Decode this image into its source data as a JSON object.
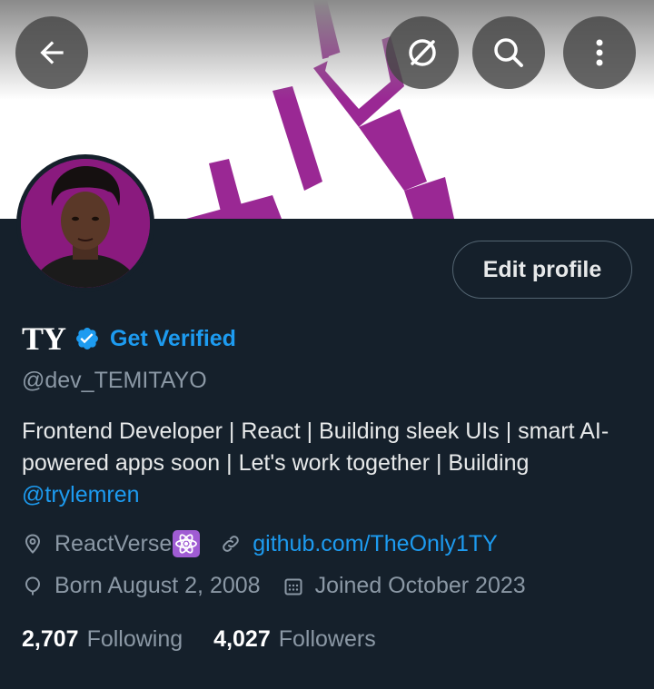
{
  "profile": {
    "display_name": "TY",
    "get_verified_label": "Get Verified",
    "handle": "@dev_TEMITAYO",
    "bio_text": "Frontend Developer | React | Building sleek UIs | smart AI-powered apps soon | Let's work together | Building ",
    "bio_mention": "@trylemren",
    "location": "ReactVerse",
    "location_emoji": "atom-symbol-emoji",
    "website": "github.com/TheOnly1TY",
    "birthday": "Born August 2, 2008",
    "joined": "Joined October 2023",
    "following_count": "2,707",
    "following_label": "Following",
    "followers_count": "4,027",
    "followers_label": "Followers"
  },
  "actions": {
    "edit_profile_label": "Edit profile"
  },
  "header_icons": [
    "back-arrow-icon",
    "grok-icon",
    "search-icon",
    "more-options-icon"
  ],
  "colors": {
    "background": "#15202b",
    "accent": "#1d9bf0",
    "banner_logo": "#9a2894",
    "muted_text": "#8b98a5"
  }
}
